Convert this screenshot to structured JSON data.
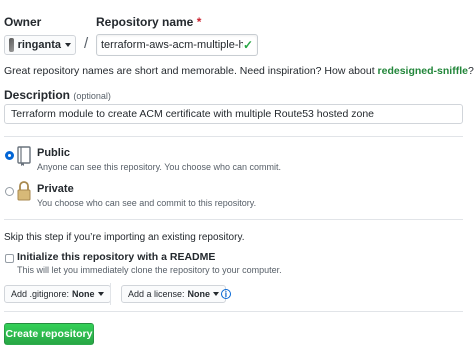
{
  "owner": {
    "label": "Owner",
    "selected": "ringanta",
    "avatar_icon": "user-avatar"
  },
  "repository": {
    "label": "Repository name",
    "required_marker": "*",
    "value": "terraform-aws-acm-multiple-hosted-zone",
    "separator": "/",
    "valid_icon": "check-icon"
  },
  "suggestion": {
    "text": "Great repository names are short and memorable. Need inspiration? How about ",
    "name": "redesigned-sniffle",
    "suffix": "?"
  },
  "description": {
    "label": "Description",
    "optional": "(optional)",
    "value": "Terraform module to create ACM certificate with multiple Route53 hosted zone"
  },
  "visibility": {
    "selected": "public",
    "public": {
      "title": "Public",
      "subtitle": "Anyone can see this repository. You choose who can commit.",
      "icon": "repo-icon"
    },
    "private": {
      "title": "Private",
      "subtitle": "You choose who can see and commit to this repository.",
      "icon": "lock-icon"
    }
  },
  "import_note": "Skip this step if you’re importing an existing repository.",
  "readme": {
    "title": "Initialize this repository with a README",
    "subtitle": "This will let you immediately clone the repository to your computer.",
    "checked": false
  },
  "gitignore": {
    "label": "Add .gitignore:",
    "value": "None"
  },
  "license": {
    "label": "Add a license:",
    "value": "None"
  },
  "info_icon": "info-icon",
  "create_button": "Create repository",
  "colors": {
    "accent": "#0366d6",
    "success": "#28a745",
    "suggestion": "#22863a",
    "required": "#cb2431"
  }
}
